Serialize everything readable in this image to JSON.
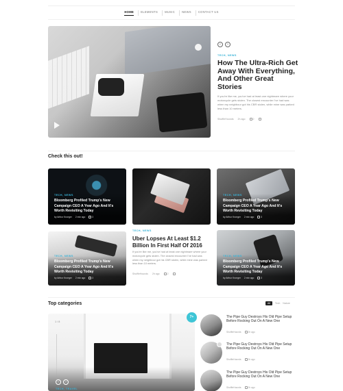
{
  "nav": {
    "items": [
      "HOME",
      "ELEMENTS",
      "MUSIC",
      "NEWS",
      "CONTACT US"
    ]
  },
  "hero": {
    "category": "TECH, NEWS",
    "title": "How The Ultra-Rich Get Away With Everything, And Other Great Stories",
    "excerpt": "If you're like me, you've had at least one nightmare where your motorcycle gets stolen. The closest encounter I've had was when my neighbour got his CBR stolen, while mine was parked less than 10 meters.",
    "author": "ShuffleHounds",
    "time": "2h ago",
    "comments": "2"
  },
  "check": {
    "title": "Check this out!",
    "cards": [
      {
        "category": "TECH, NEWS",
        "title": "Bloomberg Profiled Trump's New Campaign CEO A Year Ago And It's Worth Revisiting Today",
        "author": "by Arthur Kroeger",
        "time": "2 min ago",
        "comments": "3"
      },
      {
        "category": "TECH, NEWS",
        "title": "Bloomberg Profiled Trump's New Campaign CEO A Year Ago And It's Worth Revisiting Today",
        "author": "by Arthur Kroeger",
        "time": "2 min ago",
        "comments": "3"
      },
      {
        "category": "TECH, NEWS",
        "title": "Bloomberg Profiled Trump's New Campaign CEO A Year Ago And It's Worth Revisiting Today",
        "author": "by Arthur Kroeger",
        "time": "2 min ago",
        "comments": "3"
      },
      {
        "category": "TECH, NEWS",
        "title": "Bloomberg Profiled Trump's New Campaign CEO A Year Ago And It's Worth Revisiting Today",
        "author": "by Arthur Kroeger",
        "time": "2 min ago",
        "comments": "3"
      },
      {
        "category": "TECH, NEWS",
        "title": "Bloomberg Profiled Trump's New Campaign CEO A Year Ago And It's Worth Revisiting Today",
        "author": "by Arthur Kroeger",
        "time": "2 min ago",
        "comments": "3"
      }
    ],
    "middle": {
      "category": "TECH, NEWS",
      "title": "Uber Lopses At Least $1.2 Billion In First Half Of 2016",
      "excerpt": "If you're like me, you've had at least one nightmare where your motorcycle gets stolen. The closest encounter I've had was when my neighbour got his CBR stolen, while mine was parked less than 10 meters.",
      "author": "ShuffleHounds",
      "time": "2h ago",
      "comments": "2"
    }
  },
  "categories": {
    "title": "Top categories",
    "filters": [
      "All",
      "Tech",
      "Nature"
    ],
    "big": {
      "counter": "1 / 8",
      "category": "TECH, TRAVEL",
      "badge": "7+"
    },
    "list": [
      {
        "title": "The Pipe Guy Destroys His Old Pipe Setup Before Rocking Out On A New One",
        "author": "ShuffleHounds",
        "time": "2h ago"
      },
      {
        "title": "The Pipe Guy Destroys His Old Pipe Setup Before Rocking Out On A New One",
        "author": "ShuffleHounds",
        "time": "2h ago"
      },
      {
        "title": "The Pipe Guy Destroys His Old Pipe Setup Before Rocking Out On A New One",
        "author": "ShuffleHounds",
        "time": "2h ago"
      }
    ]
  },
  "colors": {
    "accent": "#39b3d7",
    "badge": "#3ec5d6"
  }
}
